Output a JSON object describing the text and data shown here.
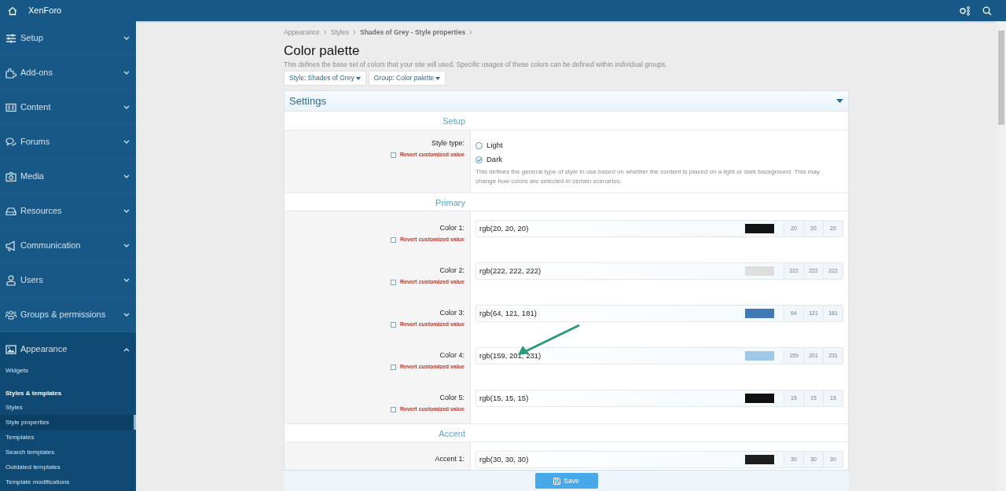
{
  "header": {
    "title": "XenForo"
  },
  "sidebar": {
    "items": [
      {
        "label": "Setup",
        "expanded": false
      },
      {
        "label": "Add-ons",
        "expanded": false
      },
      {
        "label": "Content",
        "expanded": false
      },
      {
        "label": "Forums",
        "expanded": false
      },
      {
        "label": "Media",
        "expanded": false
      },
      {
        "label": "Resources",
        "expanded": false
      },
      {
        "label": "Communication",
        "expanded": false
      },
      {
        "label": "Users",
        "expanded": false
      },
      {
        "label": "Groups & permissions",
        "expanded": false
      },
      {
        "label": "Appearance",
        "expanded": true,
        "children": [
          {
            "kind": "link",
            "label": "Widgets",
            "selected": false
          },
          {
            "kind": "heading",
            "label": "Styles & templates",
            "selected": false
          },
          {
            "kind": "link",
            "label": "Styles",
            "selected": false
          },
          {
            "kind": "link",
            "label": "Style properties",
            "selected": true
          },
          {
            "kind": "link",
            "label": "Templates",
            "selected": false
          },
          {
            "kind": "link",
            "label": "Search templates",
            "selected": false
          },
          {
            "kind": "link",
            "label": "Outdated templates",
            "selected": false
          },
          {
            "kind": "link",
            "label": "Template modifications",
            "selected": false
          }
        ]
      }
    ]
  },
  "breadcrumb": [
    "Appearance",
    "Styles",
    "Shades of Grey - Style properties"
  ],
  "title": "Color palette",
  "description": "This defines the base set of colors that your site will used. Specific usages of these colors can be defined within individual groups.",
  "filters": [
    "Style: Shades of Grey",
    "Group: Color palette"
  ],
  "panel": {
    "title": "Settings",
    "groups": [
      {
        "heading": "Setup",
        "rows": [
          {
            "kind": "radio",
            "label": "Style type:",
            "revert": {
              "label": "Revert customized value",
              "checked": false
            },
            "options": [
              {
                "label": "Light",
                "selected": false
              },
              {
                "label": "Dark",
                "selected": true
              }
            ],
            "hint": "This defines the general type of style in use based on whether the content is placed on a light or dark background. This may change how colors are selected in certain scenarios."
          }
        ]
      },
      {
        "heading": "Primary",
        "rows": [
          {
            "kind": "color",
            "label": "Color 1:",
            "revert": {
              "label": "Revert customized value",
              "checked": false
            },
            "value": "rgb(20, 20, 20)",
            "color": "#141414",
            "channels": [
              "20",
              "20",
              "20"
            ]
          },
          {
            "kind": "color",
            "label": "Color 2:",
            "revert": {
              "label": "Revert customized value",
              "checked": false
            },
            "value": "rgb(222, 222, 222)",
            "color": "#dedede",
            "channels": [
              "222",
              "222",
              "222"
            ]
          },
          {
            "kind": "color",
            "label": "Color 3:",
            "revert": {
              "label": "Revert customized value",
              "checked": false
            },
            "value": "rgb(64, 121, 181)",
            "color": "#4079b5",
            "channels": [
              "64",
              "121",
              "181"
            ]
          },
          {
            "kind": "color",
            "label": "Color 4:",
            "revert": {
              "label": "Revert customized value",
              "checked": false
            },
            "value": "rgb(159, 201, 231)",
            "color": "#9fc9e7",
            "channels": [
              "159",
              "201",
              "231"
            ]
          },
          {
            "kind": "color",
            "label": "Color 5:",
            "revert": {
              "label": "Revert customized value",
              "checked": false
            },
            "value": "rgb(15, 15, 15)",
            "color": "#0f0f0f",
            "channels": [
              "15",
              "15",
              "15"
            ]
          }
        ]
      },
      {
        "heading": "Accent",
        "rows": [
          {
            "kind": "color",
            "label": "Accent 1:",
            "value": "rgb(30, 30, 30)",
            "color": "#1e1e1e",
            "channels": [
              "30",
              "30",
              "30"
            ]
          }
        ]
      }
    ]
  },
  "save": "Save"
}
